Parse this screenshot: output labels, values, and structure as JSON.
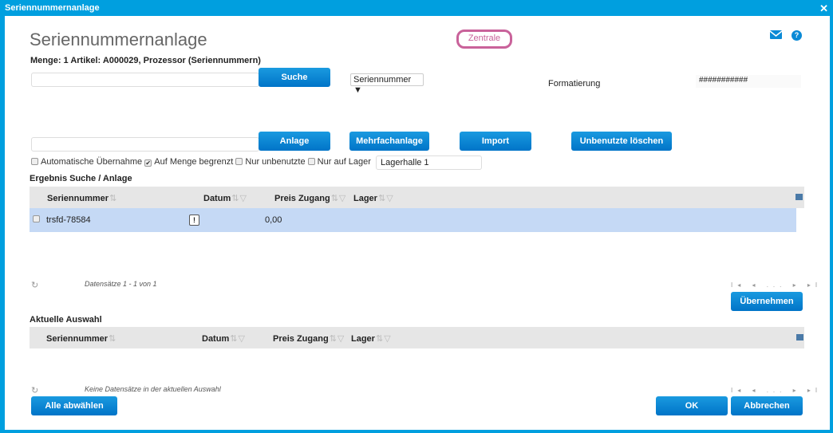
{
  "window": {
    "title": "Seriennummernanlage",
    "close": "✕"
  },
  "header": {
    "title": "Seriennummernanlage",
    "location": "Zentrale",
    "info": "Menge: 1 Artikel: A000029, Prozessor (Seriennummern)"
  },
  "search": {
    "value": "",
    "button": "Suche",
    "mode": "Seriennummer ▼",
    "format_label": "Formatierung",
    "format_value": "###########"
  },
  "create": {
    "value": "",
    "buttons": [
      "Anlage",
      "Mehrfachanlage",
      "Import",
      "Unbenutzte löschen"
    ]
  },
  "options": [
    {
      "label": "Automatische Übernahme",
      "checked": false
    },
    {
      "label": "Auf Menge begrenzt",
      "checked": true
    },
    {
      "label": "Nur unbenutzte",
      "checked": false
    },
    {
      "label": "Nur auf Lager",
      "checked": false
    }
  ],
  "lager_value": "Lagerhalle 1",
  "result": {
    "title": "Ergebnis Suche / Anlage",
    "columns": [
      "Seriennummer",
      "Datum",
      "Preis Zugang",
      "Lager"
    ],
    "rows": [
      {
        "seriennummer": "trsfd-78584",
        "datum": "!",
        "preis": "0,00",
        "lager": ""
      }
    ],
    "status": "Datensätze 1 - 1 von 1",
    "pager": "I◂ ◂ ... ▸ ▸I",
    "apply": "Übernehmen"
  },
  "selection": {
    "title": "Aktuelle Auswahl",
    "columns": [
      "Seriennummer",
      "Datum",
      "Preis Zugang",
      "Lager"
    ],
    "status": "Keine Datensätze in der aktuellen Auswahl",
    "pager": "I◂ ◂ ... ▸ ▸I"
  },
  "footer": {
    "deselect": "Alle abwählen",
    "ok": "OK",
    "cancel": "Abbrechen"
  },
  "colors": {
    "accent": "#009fdf",
    "button": "#0a86d4",
    "location": "#c9629a",
    "row_selected": "#c5d9f5"
  }
}
